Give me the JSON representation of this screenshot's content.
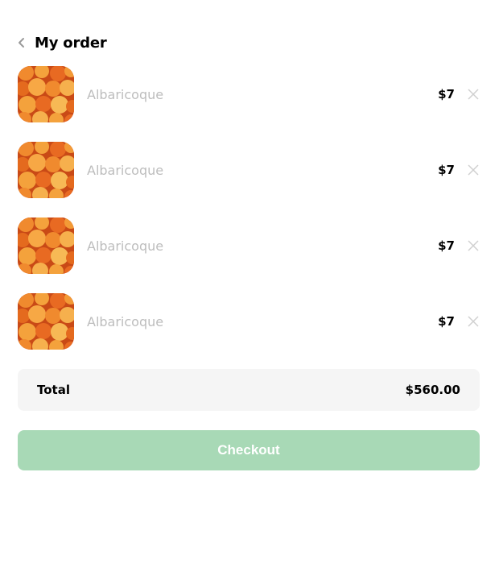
{
  "header": {
    "back_icon": "chevron-left-icon",
    "title": "My order"
  },
  "items": [
    {
      "name": "Albaricoque",
      "price": "$7",
      "image": "apricots-image",
      "remove_icon": "close-icon"
    },
    {
      "name": "Albaricoque",
      "price": "$7",
      "image": "apricots-image",
      "remove_icon": "close-icon"
    },
    {
      "name": "Albaricoque",
      "price": "$7",
      "image": "apricots-image",
      "remove_icon": "close-icon"
    },
    {
      "name": "Albaricoque",
      "price": "$7",
      "image": "apricots-image",
      "remove_icon": "close-icon"
    }
  ],
  "summary": {
    "total_label": "Total",
    "total_value": "$560.00"
  },
  "checkout": {
    "label": "Checkout"
  },
  "colors": {
    "checkout_bg": "#a8d9b6",
    "total_bg": "#f5f5f5",
    "item_name": "#bdbdbd",
    "icon_gray": "#c8c8c8"
  }
}
